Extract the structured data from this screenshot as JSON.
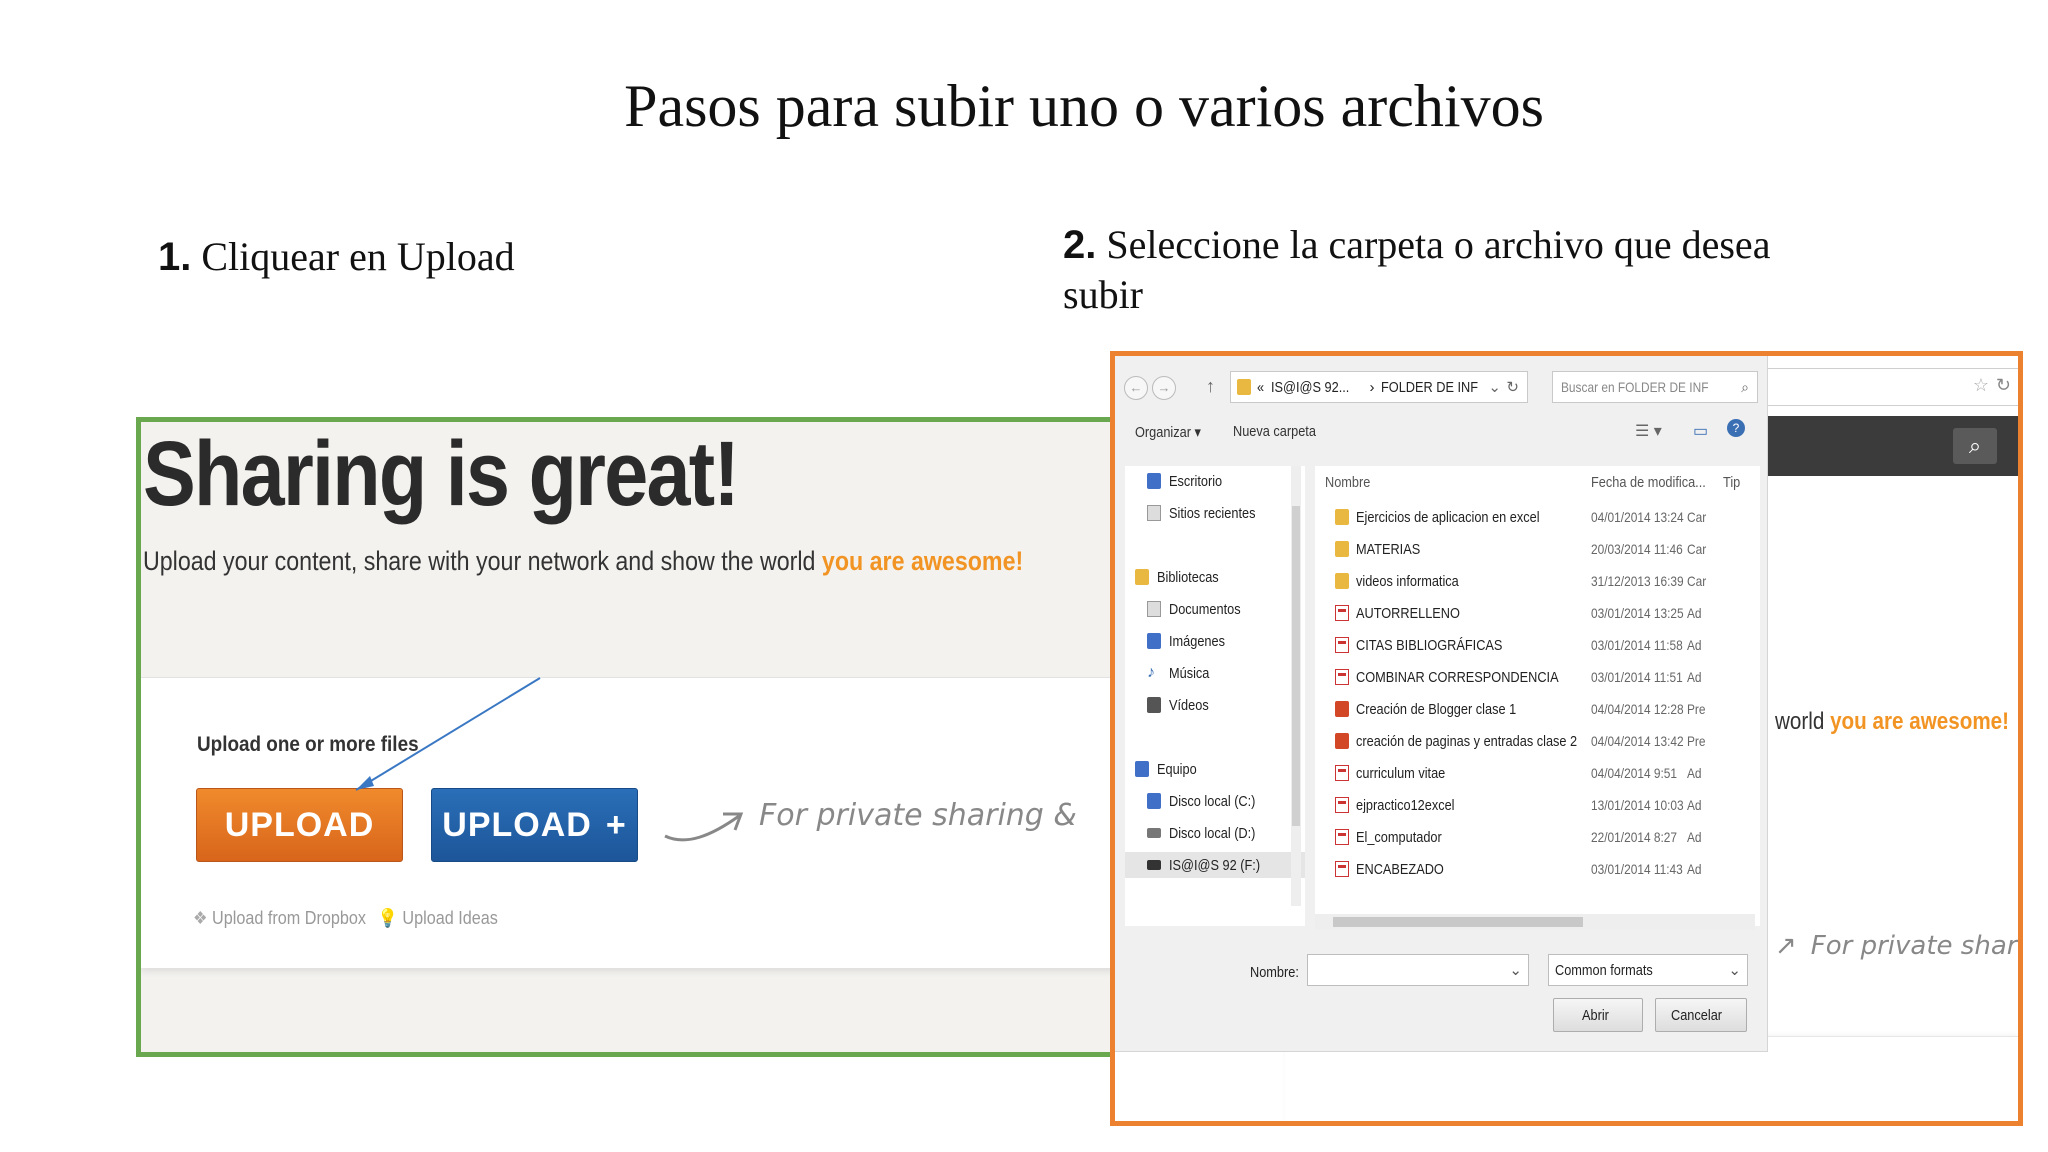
{
  "slide": {
    "title": "Pasos para subir uno o varios archivos",
    "step1": {
      "num": "1.",
      "text": " Cliquear en Upload"
    },
    "step2": {
      "num": "2.",
      "text": " Seleccione la carpeta o archivo que desea",
      "text2": "subir"
    }
  },
  "left_screenshot": {
    "headline": "Sharing is great!",
    "tagline": "Upload your content, share with your network and show the world ",
    "tagline_highlight": "you are awesome!",
    "files_label": "Upload one or more files",
    "upload_button": "UPLOAD",
    "upload_plus_button": "UPLOAD",
    "plus": "+",
    "private_text": "For private sharing &",
    "dropbox_link": "Upload from Dropbox",
    "ideas_link": "Upload Ideas",
    "accent": "#f29423"
  },
  "right_screenshot": {
    "background_text": "world ",
    "background_highlight": "you are awesome!",
    "background_private": "For private shari",
    "dialog": {
      "path_prefix": "«",
      "path_1": "IS@I@S 92...",
      "path_sep": "›",
      "path_2": "FOLDER DE INF",
      "search_placeholder": "Buscar en FOLDER DE INF",
      "organize": "Organizar ▾",
      "new_folder": "Nueva carpeta",
      "nav": {
        "escritorio": "Escritorio",
        "recientes": "Sitios recientes",
        "bibliotecas": "Bibliotecas",
        "documentos": "Documentos",
        "imagenes": "Imágenes",
        "musica": "Música",
        "videos": "Vídeos",
        "equipo": "Equipo",
        "disco_c": "Disco local (C:)",
        "disco_d": "Disco local (D:)",
        "usb": "IS@I@S 92 (F:)"
      },
      "col_name": "Nombre",
      "col_date": "Fecha de modifica...",
      "col_type": "Tip",
      "files": [
        {
          "name": "Ejercicios de aplicacion en excel",
          "date": "04/01/2014 13:24",
          "type": "Car"
        },
        {
          "name": "MATERIAS",
          "date": "20/03/2014 11:46",
          "type": "Car"
        },
        {
          "name": "videos informatica",
          "date": "31/12/2013 16:39",
          "type": "Car"
        },
        {
          "name": "AUTORRELLENO",
          "date": "03/01/2014 13:25",
          "type": "Ad"
        },
        {
          "name": "CITAS BIBLIOGRÁFICAS",
          "date": "03/01/2014 11:58",
          "type": "Ad"
        },
        {
          "name": "COMBINAR CORRESPONDENCIA",
          "date": "03/01/2014 11:51",
          "type": "Ad"
        },
        {
          "name": "Creación de Blogger clase 1",
          "date": "04/04/2014 12:28",
          "type": "Pre"
        },
        {
          "name": "creación de paginas y entradas clase 2",
          "date": "04/04/2014 13:42",
          "type": "Pre"
        },
        {
          "name": "curriculum vitae",
          "date": "04/04/2014 9:51",
          "type": "Ad"
        },
        {
          "name": "ejpractico12excel",
          "date": "13/01/2014 10:03",
          "type": "Ad"
        },
        {
          "name": "El_computador",
          "date": "22/01/2014 8:27",
          "type": "Ad"
        },
        {
          "name": "ENCABEZADO",
          "date": "03/01/2014 11:43",
          "type": "Ad"
        }
      ],
      "filename_label": "Nombre:",
      "filename_value": "",
      "filter": "Common formats",
      "open": "Abrir",
      "cancel": "Cancelar"
    }
  }
}
